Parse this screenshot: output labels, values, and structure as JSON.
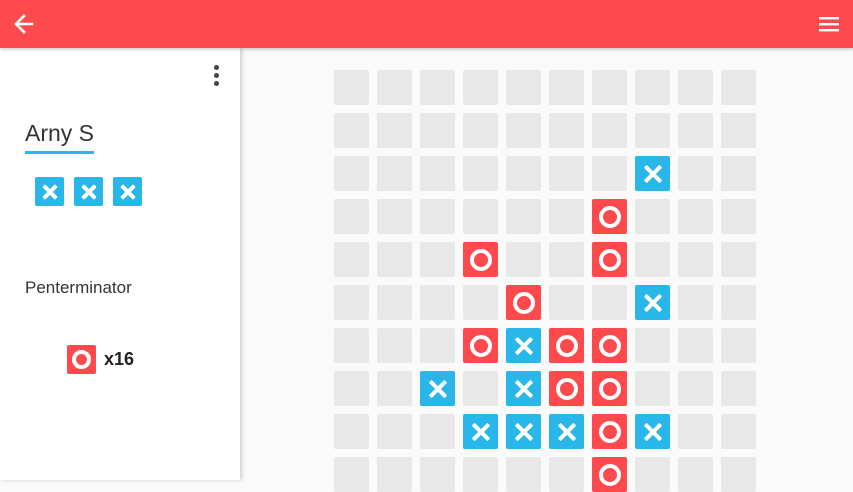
{
  "colors": {
    "accent": "#ff4a4d",
    "x_mark": "#29b6e8",
    "o_mark": "#ff4a4d",
    "empty_cell": "#e8e8e8"
  },
  "icons": {
    "back": "arrow-left-icon",
    "menu": "hamburger-menu-icon",
    "more": "more-vertical-icon"
  },
  "player1": {
    "name": "Arny S",
    "mark": "x",
    "marks_shown": 3
  },
  "player2": {
    "name": "Penterminator",
    "mark": "o",
    "count": "x16"
  },
  "board": {
    "columns": 10,
    "rows": [
      "..........",
      "..........",
      ".......X..",
      "......O...",
      "...O..O...",
      "....O..X..",
      "...OXOO...",
      "..X.XOO...",
      "...XXXOX..",
      "......O..."
    ]
  }
}
